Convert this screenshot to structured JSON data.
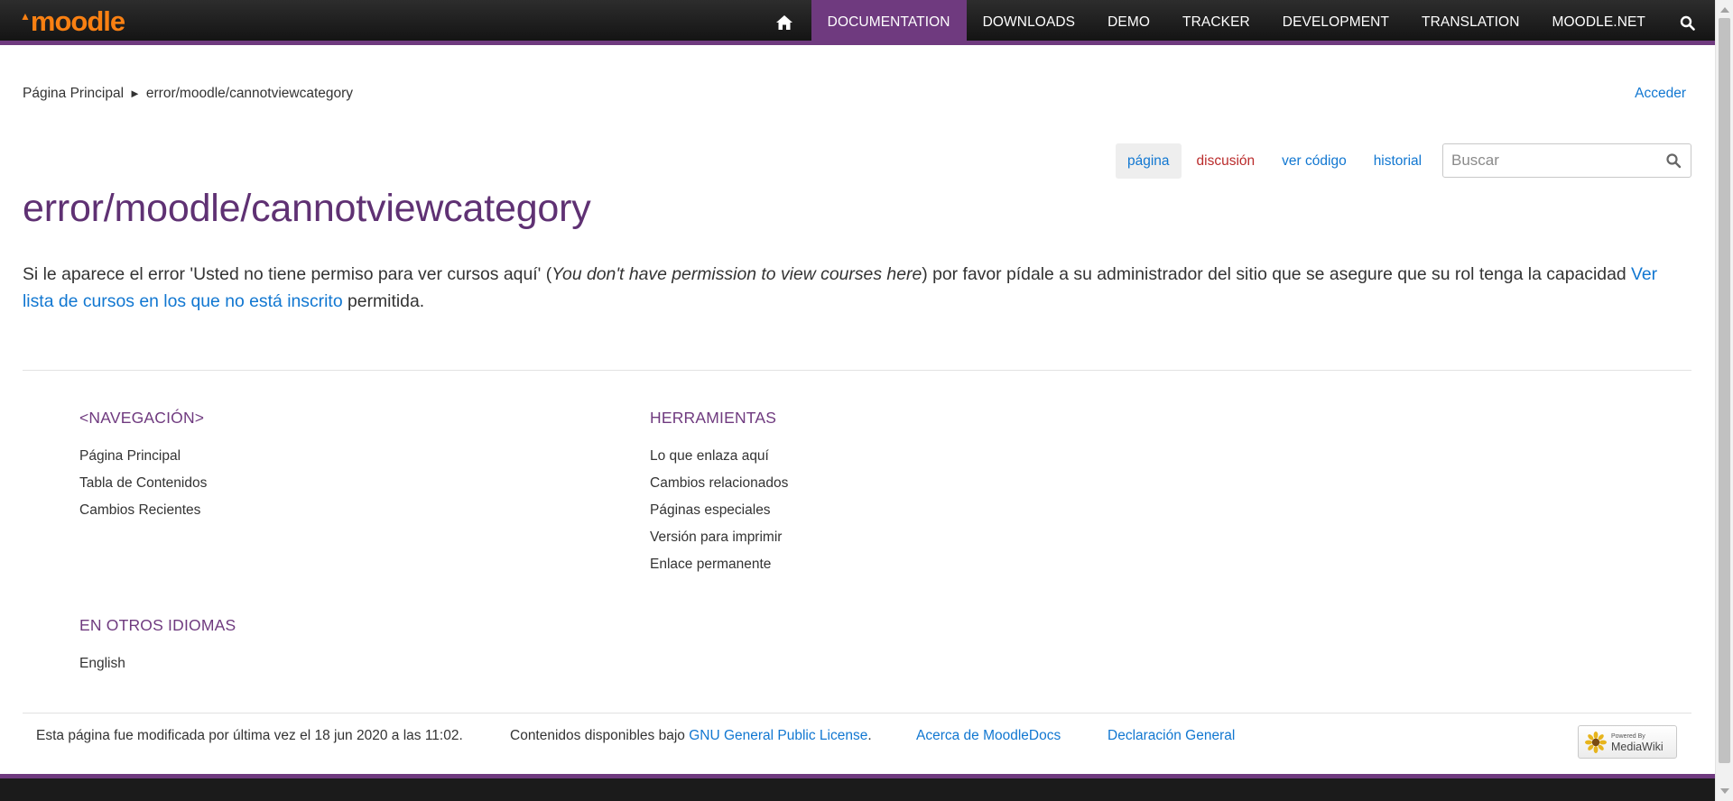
{
  "header": {
    "logo_text": "moodle",
    "nav_items": [
      "DOCUMENTATION",
      "DOWNLOADS",
      "DEMO",
      "TRACKER",
      "DEVELOPMENT",
      "TRANSLATION",
      "MOODLE.NET"
    ],
    "active_item": "DOCUMENTATION",
    "accent_color": "#6f3a7f",
    "logo_color": "#f98012"
  },
  "breadcrumb": {
    "home": "Página Principal",
    "separator": "►",
    "current": "error/moodle/cannotviewcategory"
  },
  "login_link": "Acceder",
  "page_tabs": [
    "página",
    "discusión",
    "ver código",
    "historial"
  ],
  "search": {
    "placeholder": "Buscar"
  },
  "page": {
    "title": "error/moodle/cannotviewcategory",
    "text_before": "Si le aparece el error 'Usted no tiene permiso para ver cursos aquí' (",
    "text_italic": "You don't have permission to view courses here",
    "text_middle": ") por favor pídale a su administrador del sitio que se asegure que su rol tenga la capacidad ",
    "link_text": "Ver lista de cursos en los que no está inscrito",
    "text_after": " permitida."
  },
  "footer_nav": {
    "heading": "<NAVEGACIÓN>",
    "links": [
      "Página Principal",
      "Tabla de Contenidos",
      "Cambios Recientes"
    ]
  },
  "footer_tools": {
    "heading": "HERRAMIENTAS",
    "links": [
      "Lo que enlaza aquí",
      "Cambios relacionados",
      "Páginas especiales",
      "Versión para imprimir",
      "Enlace permanente"
    ]
  },
  "footer_lang": {
    "heading": "EN OTROS IDIOMAS",
    "links": [
      "English"
    ]
  },
  "footer": {
    "last_modified": "Esta página fue modificada por última vez el 18 jun 2020 a las 11:02.",
    "license_prefix": "Contenidos disponibles bajo ",
    "license_link": "GNU General Public License",
    "license_suffix": ".",
    "about": "Acerca de MoodleDocs",
    "disclaimer": "Declaración General",
    "powered_small": "Powered By",
    "powered_big": "MediaWiki"
  }
}
